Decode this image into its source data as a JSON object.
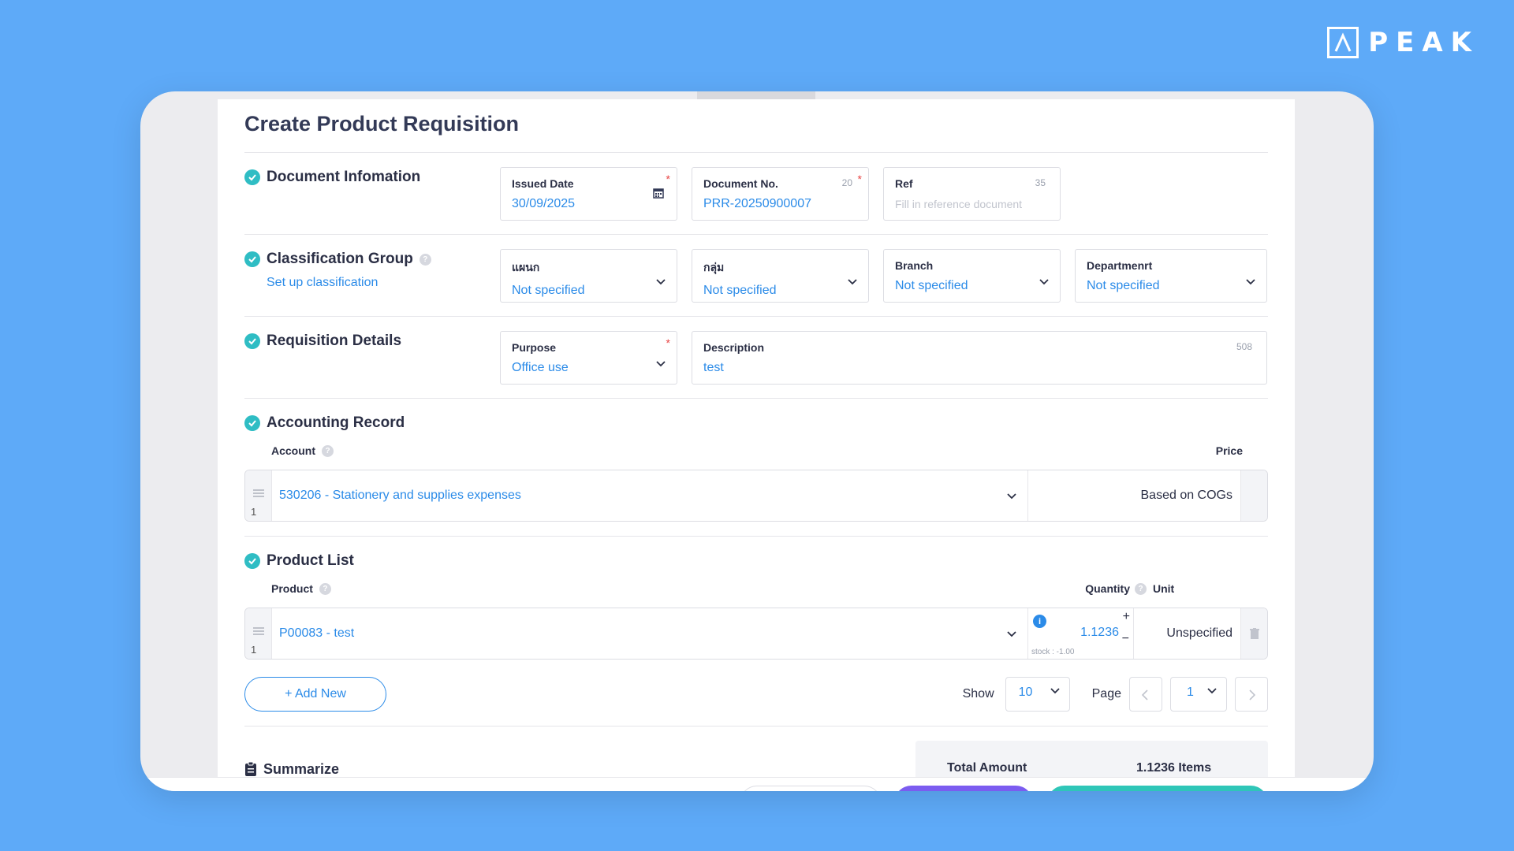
{
  "brand": {
    "name": "PEAK"
  },
  "page": {
    "title": "Create Product Requisition"
  },
  "document_info": {
    "heading": "Document Infomation",
    "issued_date": {
      "label": "Issued Date",
      "value": "30/09/2025"
    },
    "document_no": {
      "label": "Document No.",
      "value": "PRR-20250900007",
      "max": "20"
    },
    "ref": {
      "label": "Ref",
      "placeholder": "Fill in reference document",
      "max": "35"
    }
  },
  "classification": {
    "heading": "Classification Group",
    "setup_link": "Set up classification",
    "fields": [
      {
        "label": "แผนก",
        "value": "Not specified"
      },
      {
        "label": "กลุ่ม",
        "value": "Not specified"
      },
      {
        "label": "Branch",
        "value": "Not specified"
      },
      {
        "label": "Departmenrt",
        "value": "Not specified"
      }
    ]
  },
  "requisition": {
    "heading": "Requisition Details",
    "purpose": {
      "label": "Purpose",
      "value": "Office use"
    },
    "description": {
      "label": "Description",
      "value": "test",
      "max": "508"
    }
  },
  "accounting": {
    "heading": "Accounting Record",
    "col_account": "Account",
    "col_price": "Price",
    "rows": [
      {
        "num": "1",
        "account": "530206 - Stationery and supplies expenses",
        "price": "Based on COGs"
      }
    ]
  },
  "products": {
    "heading": "Product List",
    "col_product": "Product",
    "col_quantity": "Quantity",
    "col_unit": "Unit",
    "rows": [
      {
        "num": "1",
        "product": "P00083 - test",
        "quantity": "1.1236",
        "stock": "stock : -1.00",
        "unit": "Unspecified"
      }
    ],
    "add_label": "+ Add New",
    "show_label": "Show",
    "show_value": "10",
    "page_label": "Page",
    "page_value": "1"
  },
  "summary": {
    "heading": "Summarize",
    "total_label": "Total Amount",
    "total_value": "1.1236 Items"
  },
  "colors": {
    "background": "#5eaaf8",
    "accent": "#2b8be8",
    "check": "#2fbdc4",
    "required": "#e84545"
  }
}
